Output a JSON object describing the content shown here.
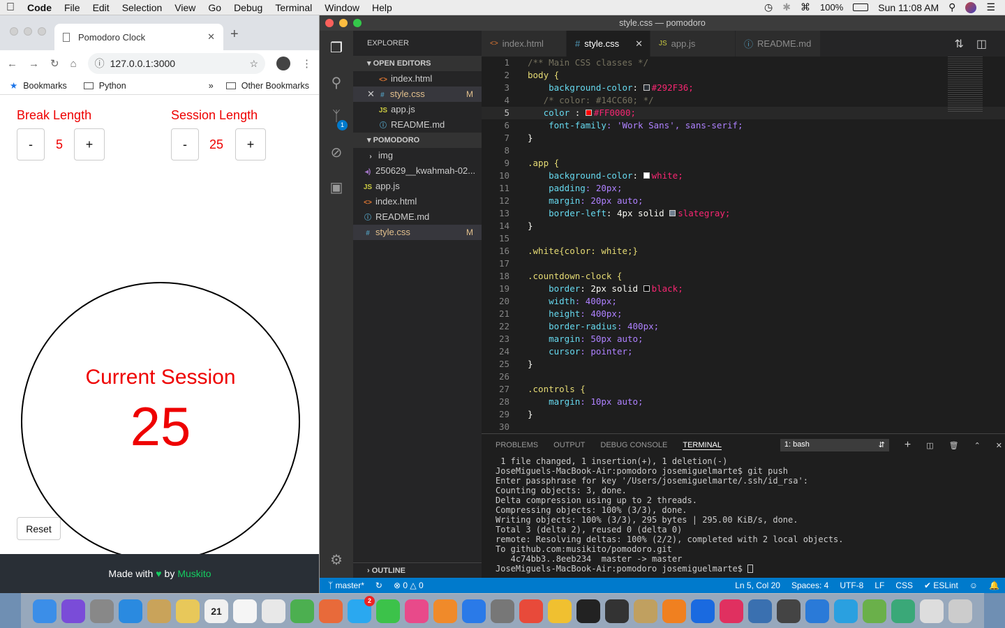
{
  "menubar": {
    "apple": "",
    "app": "Code",
    "items": [
      "File",
      "Edit",
      "Selection",
      "View",
      "Go",
      "Debug",
      "Terminal",
      "Window",
      "Help"
    ],
    "battery": "100%",
    "clock": "Sun 11:08 AM"
  },
  "browser": {
    "tab_title": "Pomodoro Clock",
    "url": "127.0.0.1:3000",
    "bookmarks": [
      "Bookmarks",
      "Python"
    ],
    "other_bookmarks": "Other Bookmarks",
    "more": "»"
  },
  "pomodoro": {
    "break_label": "Break Length",
    "break_value": "5",
    "session_label": "Session Length",
    "session_value": "25",
    "minus": "-",
    "plus": "+",
    "clock_title": "Current Session",
    "clock_value": "25",
    "reset": "Reset",
    "footer_prefix": "Made with",
    "footer_by": "by",
    "footer_author": "Muskito"
  },
  "vscode": {
    "window_title": "style.css — pomodoro",
    "explorer": "EXPLORER",
    "open_editors": "OPEN EDITORS",
    "open_files": [
      {
        "name": "index.html",
        "icon": "<>",
        "mod": ""
      },
      {
        "name": "style.css",
        "icon": "#",
        "mod": "M"
      },
      {
        "name": "app.js",
        "icon": "JS",
        "mod": ""
      },
      {
        "name": "README.md",
        "icon": "ⓘ",
        "mod": ""
      }
    ],
    "project": "POMODORO",
    "tree": [
      {
        "name": "img",
        "icon": "›",
        "mod": ""
      },
      {
        "name": "250629__kwahmah-02...",
        "icon": "◂)",
        "mod": ""
      },
      {
        "name": "app.js",
        "icon": "JS",
        "mod": ""
      },
      {
        "name": "index.html",
        "icon": "<>",
        "mod": ""
      },
      {
        "name": "README.md",
        "icon": "ⓘ",
        "mod": ""
      },
      {
        "name": "style.css",
        "icon": "#",
        "mod": "M"
      }
    ],
    "outline": "OUTLINE",
    "tabs": [
      "index.html",
      "style.css",
      "app.js",
      "README.md"
    ],
    "tab_icons": [
      "<>",
      "#",
      "JS",
      "ⓘ"
    ],
    "panel_tabs": [
      "PROBLEMS",
      "OUTPUT",
      "DEBUG CONSOLE",
      "TERMINAL"
    ],
    "terminal_select": "1: bash",
    "terminal_lines": [
      " 1 file changed, 1 insertion(+), 1 deletion(-)",
      "JoseMiguels-MacBook-Air:pomodoro josemiguelmarte$ git push",
      "Enter passphrase for key '/Users/josemiguelmarte/.ssh/id_rsa':",
      "Counting objects: 3, done.",
      "Delta compression using up to 2 threads.",
      "Compressing objects: 100% (3/3), done.",
      "Writing objects: 100% (3/3), 295 bytes | 295.00 KiB/s, done.",
      "Total 3 (delta 2), reused 0 (delta 0)",
      "remote: Resolving deltas: 100% (2/2), completed with 2 local objects.",
      "To github.com:musikito/pomodoro.git",
      "   4c74bb3..8eeb234  master -> master",
      "JoseMiguels-MacBook-Air:pomodoro josemiguelmarte$ "
    ],
    "status": {
      "branch": "master*",
      "errors": "0",
      "warnings": "0",
      "position": "Ln 5, Col 20",
      "spaces": "Spaces: 4",
      "encoding": "UTF-8",
      "eol": "LF",
      "lang": "CSS",
      "lint": "ESLint"
    },
    "scm_badge": "1"
  },
  "code_lines": [
    "/** Main CSS classes */",
    "body {",
    "    background-color: #292F36;",
    "   /* color: #14CC60; */",
    "   color : #FF0000;",
    "    font-family: 'Work Sans', sans-serif;",
    "}",
    "",
    ".app {",
    "    background-color: white;",
    "    padding: 20px;",
    "    margin: 20px auto;",
    "    border-left: 4px solid slategray;",
    "}",
    "",
    ".white{color: white;}",
    "",
    ".countdown-clock {",
    "    border: 2px solid black;",
    "    width: 400px;",
    "    height: 400px;",
    "    border-radius: 400px;",
    "    margin: 50px auto;",
    "    cursor: pointer;",
    "}",
    "",
    ".controls {",
    "    margin: 10px auto;",
    "}",
    ""
  ],
  "colors": {
    "accent_red": "#FF0000",
    "vscode_blue": "#007ACC",
    "footer_bg": "#292F36",
    "heart": "#14CC60"
  },
  "dock_icons": [
    "finder-icon",
    "siri-icon",
    "launchpad-icon",
    "safari-icon",
    "mail-icon",
    "notes-icon",
    "calendar-icon",
    "stickies-icon",
    "reminders-icon",
    "maps-icon",
    "photos-icon",
    "messages-icon",
    "facetime-icon",
    "itunes-icon",
    "books-icon",
    "appstore-icon",
    "preferences-icon",
    "chrome-icon",
    "cyberduck-icon",
    "terminal-icon",
    "terminal2-icon",
    "vpn-icon",
    "sublime-icon",
    "maps2-icon",
    "flickr-icon",
    "python-icon",
    "unity-icon",
    "vscode-icon",
    "xcode-icon",
    "android-icon",
    "atom-icon",
    "finder2-icon",
    "trash-icon"
  ],
  "dock_badge": "2",
  "dock_date": "21"
}
